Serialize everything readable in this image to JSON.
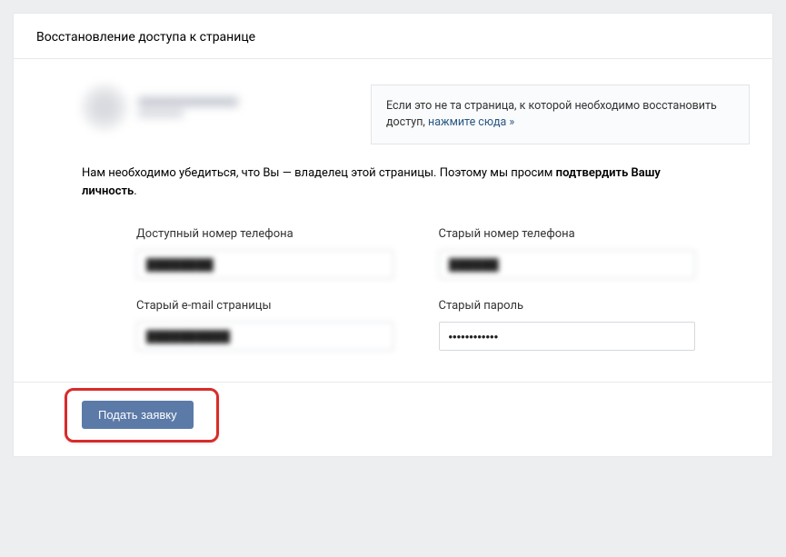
{
  "header": {
    "title": "Восстановление доступа к странице"
  },
  "notice": {
    "text_before": "Если это не та страница, к которой необходимо восстановить доступ, ",
    "link": "нажмите сюда »"
  },
  "intro": {
    "part1": "Нам необходимо убедиться, что Вы — владелец этой страницы. Поэтому мы просим ",
    "bold": "подтвердить Вашу личность",
    "part2": "."
  },
  "fields": {
    "available_phone": {
      "label": "Доступный номер телефона",
      "value": "blurred"
    },
    "old_phone": {
      "label": "Старый номер телефона",
      "value": "blurred"
    },
    "old_email": {
      "label": "Старый e-mail страницы",
      "value": "blurred"
    },
    "old_password": {
      "label": "Старый пароль",
      "value": "••••••••••••"
    }
  },
  "footer": {
    "submit": "Подать заявку"
  }
}
